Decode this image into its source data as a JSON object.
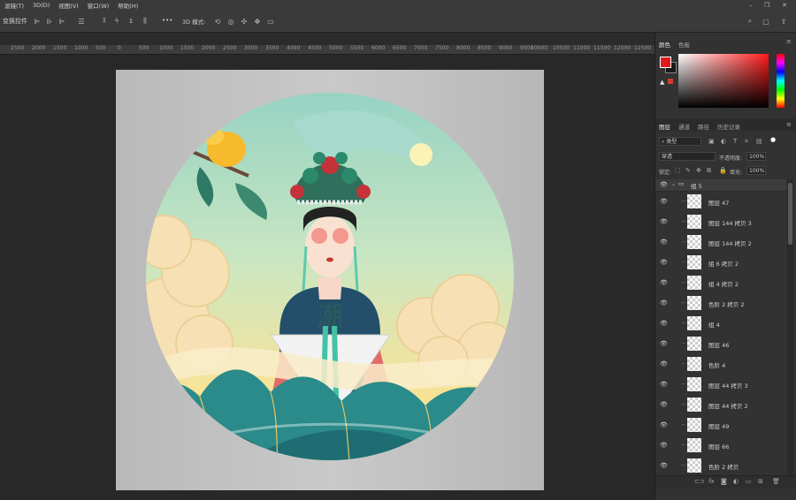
{
  "menu": [
    "滤镜(T)",
    "3D(D)",
    "视图(V)",
    "窗口(W)",
    "帮助(H)"
  ],
  "options": {
    "transform_label": "变换控件",
    "mode3d_label": "3D 模式:",
    "more": "•••"
  },
  "ruler_ticks": [
    "2500",
    "2000",
    "1500",
    "1000",
    "500",
    "0",
    "500",
    "1000",
    "1500",
    "2000",
    "2500",
    "3000",
    "3500",
    "4000",
    "4500",
    "5000",
    "5500",
    "6000",
    "6500",
    "7000",
    "7500",
    "8000",
    "8500",
    "9000",
    "9500",
    "10000",
    "10500",
    "11000",
    "11500",
    "12000",
    "12500"
  ],
  "artwork": {
    "calligraphy": "潮"
  },
  "color_panel": {
    "tabs": [
      "颜色",
      "色板"
    ],
    "foreground": "#e01a1a",
    "background": "#1a1a1a"
  },
  "layers_panel": {
    "tabs": [
      "图层",
      "通道",
      "路径",
      "历史记录"
    ],
    "filter_kind": "类型",
    "blend_mode": "穿透",
    "opacity_label": "不透明度:",
    "opacity_value": "100%",
    "lock_label": "锁定:",
    "fill_label": "填充:",
    "fill_value": "100%",
    "group": "组 5",
    "layers": [
      "图层 47",
      "图层 144 拷贝 3",
      "图层 144 拷贝 2",
      "组 6 拷贝 2",
      "组 4 拷贝 2",
      "色阶 2 拷贝 2",
      "组 4",
      "图层 46",
      "色阶 4",
      "图层 44 拷贝 3",
      "图层 44 拷贝 2",
      "图层 49",
      "图层 66",
      "色阶 2 拷贝"
    ],
    "footer_icons": [
      "link-icon",
      "fx-icon",
      "mask-icon",
      "adjustment-icon",
      "folder-icon",
      "new-layer-icon",
      "trash-icon"
    ]
  }
}
